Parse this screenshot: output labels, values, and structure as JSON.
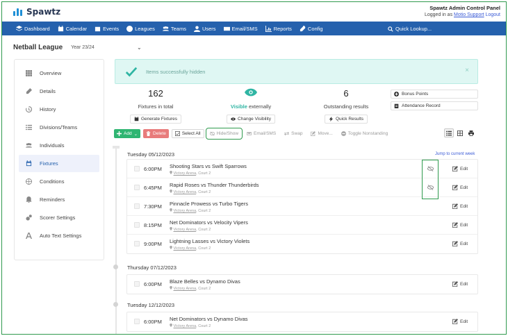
{
  "app": {
    "name": "Spawtz"
  },
  "admin": {
    "title": "Spawtz Admin Control Panel",
    "logged_in_prefix": "Logged in as",
    "user": "Motio Support",
    "logout": "Logout"
  },
  "nav": [
    {
      "label": "Dashboard",
      "icon": "dashboard-icon"
    },
    {
      "label": "Calendar",
      "icon": "calendar-icon"
    },
    {
      "label": "Events",
      "icon": "events-icon"
    },
    {
      "label": "Leagues",
      "icon": "leagues-icon"
    },
    {
      "label": "Teams",
      "icon": "teams-icon"
    },
    {
      "label": "Users",
      "icon": "users-icon"
    },
    {
      "label": "Email/SMS",
      "icon": "email-icon"
    },
    {
      "label": "Reports",
      "icon": "reports-icon"
    },
    {
      "label": "Config",
      "icon": "config-icon"
    }
  ],
  "quick_lookup": "Quick Lookup...",
  "league": {
    "name": "Netball League",
    "year": "Year 23/24"
  },
  "sidebar": [
    {
      "label": "Overview"
    },
    {
      "label": "Details"
    },
    {
      "label": "History"
    },
    {
      "label": "Divisions/Teams"
    },
    {
      "label": "Individuals"
    },
    {
      "label": "Fixtures",
      "active": true
    },
    {
      "label": "Conditions"
    },
    {
      "label": "Reminders"
    },
    {
      "label": "Scorer Settings"
    },
    {
      "label": "Auto Text Settings"
    }
  ],
  "alert": {
    "message": "Items successfully hidden",
    "close": "×"
  },
  "stats": {
    "fixtures": {
      "value": "162",
      "label": "Fixtures in total",
      "button": "Generate Fixtures"
    },
    "visibility": {
      "highlight": "Visible",
      "label_rest": " externally",
      "button": "Change Visibility"
    },
    "outstanding": {
      "value": "6",
      "label": "Outstanding results",
      "button": "Quick Results"
    }
  },
  "side_buttons": {
    "bonus": "Bonus Points",
    "attendance": "Attendance Record"
  },
  "toolbar": {
    "add": "Add",
    "delete": "Delete",
    "select_all": "Select All",
    "hide_show": "Hide/Show",
    "email_sms": "Email/SMS",
    "swap": "Swap",
    "move": "Move...",
    "toggle": "Toggle Nonstanding"
  },
  "jump_link": "Jump to current week",
  "days": [
    {
      "title": "Tuesday 05/12/2023",
      "fixtures": [
        {
          "time": "6:00PM",
          "match": "Shooting Stars vs Swift Sparrows",
          "venue": "Victory Arena",
          "court": ", Court 2",
          "hidden": true
        },
        {
          "time": "6:45PM",
          "match": "Rapid Roses vs Thunder Thunderbirds",
          "venue": "Victory Arena",
          "court": ", Court 2",
          "hidden": true
        },
        {
          "time": "7:30PM",
          "match": "Pinnacle Prowess vs Turbo Tigers",
          "venue": "Victory Arena",
          "court": ", Court 2",
          "hidden": false
        },
        {
          "time": "8:15PM",
          "match": "Net Dominators vs Velocity Vipers",
          "venue": "Victory Arena",
          "court": ", Court 2",
          "hidden": false
        },
        {
          "time": "9:00PM",
          "match": "Lightning Lasses vs Victory Violets",
          "venue": "Victory Arena",
          "court": ", Court 2",
          "hidden": false
        }
      ]
    },
    {
      "title": "Thursday 07/12/2023",
      "fixtures": [
        {
          "time": "6:00PM",
          "match": "Blaze Belles vs Dynamo Divas",
          "venue": "Victory Arena",
          "court": ", Court 2",
          "hidden": false
        }
      ]
    },
    {
      "title": "Tuesday 12/12/2023",
      "fixtures": [
        {
          "time": "6:00PM",
          "match": "Net Dominators vs Dynamo Divas",
          "venue": "Victory Arena",
          "court": ", Court 2",
          "hidden": false
        }
      ]
    }
  ],
  "edit_label": "Edit",
  "colors": {
    "nav": "#2561ad",
    "accent": "#2fb5a3",
    "add": "#2fb572",
    "delete": "#e87b7b",
    "highlight": "#2e9a4d"
  }
}
